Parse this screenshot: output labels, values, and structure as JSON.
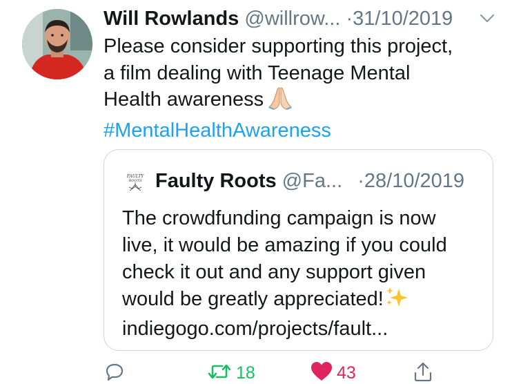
{
  "tweet": {
    "author_name": "Will Rowlands",
    "author_handle": "@willrow...",
    "separator": "·",
    "date": "31/10/2019",
    "text_lines": [
      "Please consider supporting this project,",
      "a film dealing with Teenage Mental",
      "Health awareness"
    ],
    "emoji": "folded-hands-emoji",
    "hashtag": "#MentalHealthAwareness",
    "caret_icon": "chevron-down-icon"
  },
  "quoted_tweet": {
    "logo_text": "FAULTY ROOTS",
    "author_name": "Faulty Roots",
    "author_handle": "@Fa...",
    "separator": "·",
    "date": "28/10/2019",
    "text_lines": [
      "The crowdfunding campaign is now",
      "live, it would be amazing if you could",
      "check it out and any support given",
      "would be greatly appreciated!"
    ],
    "emoji": "sparkles-emoji",
    "link": "indiegogo.com/projects/fault..."
  },
  "actions": {
    "reply_icon": "reply-icon",
    "retweet_icon": "retweet-icon",
    "retweet_count": "18",
    "like_icon": "heart-icon",
    "like_count": "43",
    "share_icon": "share-icon"
  },
  "colors": {
    "link_blue": "#1da1f2",
    "retweet_green": "#17bf63",
    "like_red": "#e0245e",
    "muted_gray": "#657786",
    "border": "#ccd6dd"
  }
}
